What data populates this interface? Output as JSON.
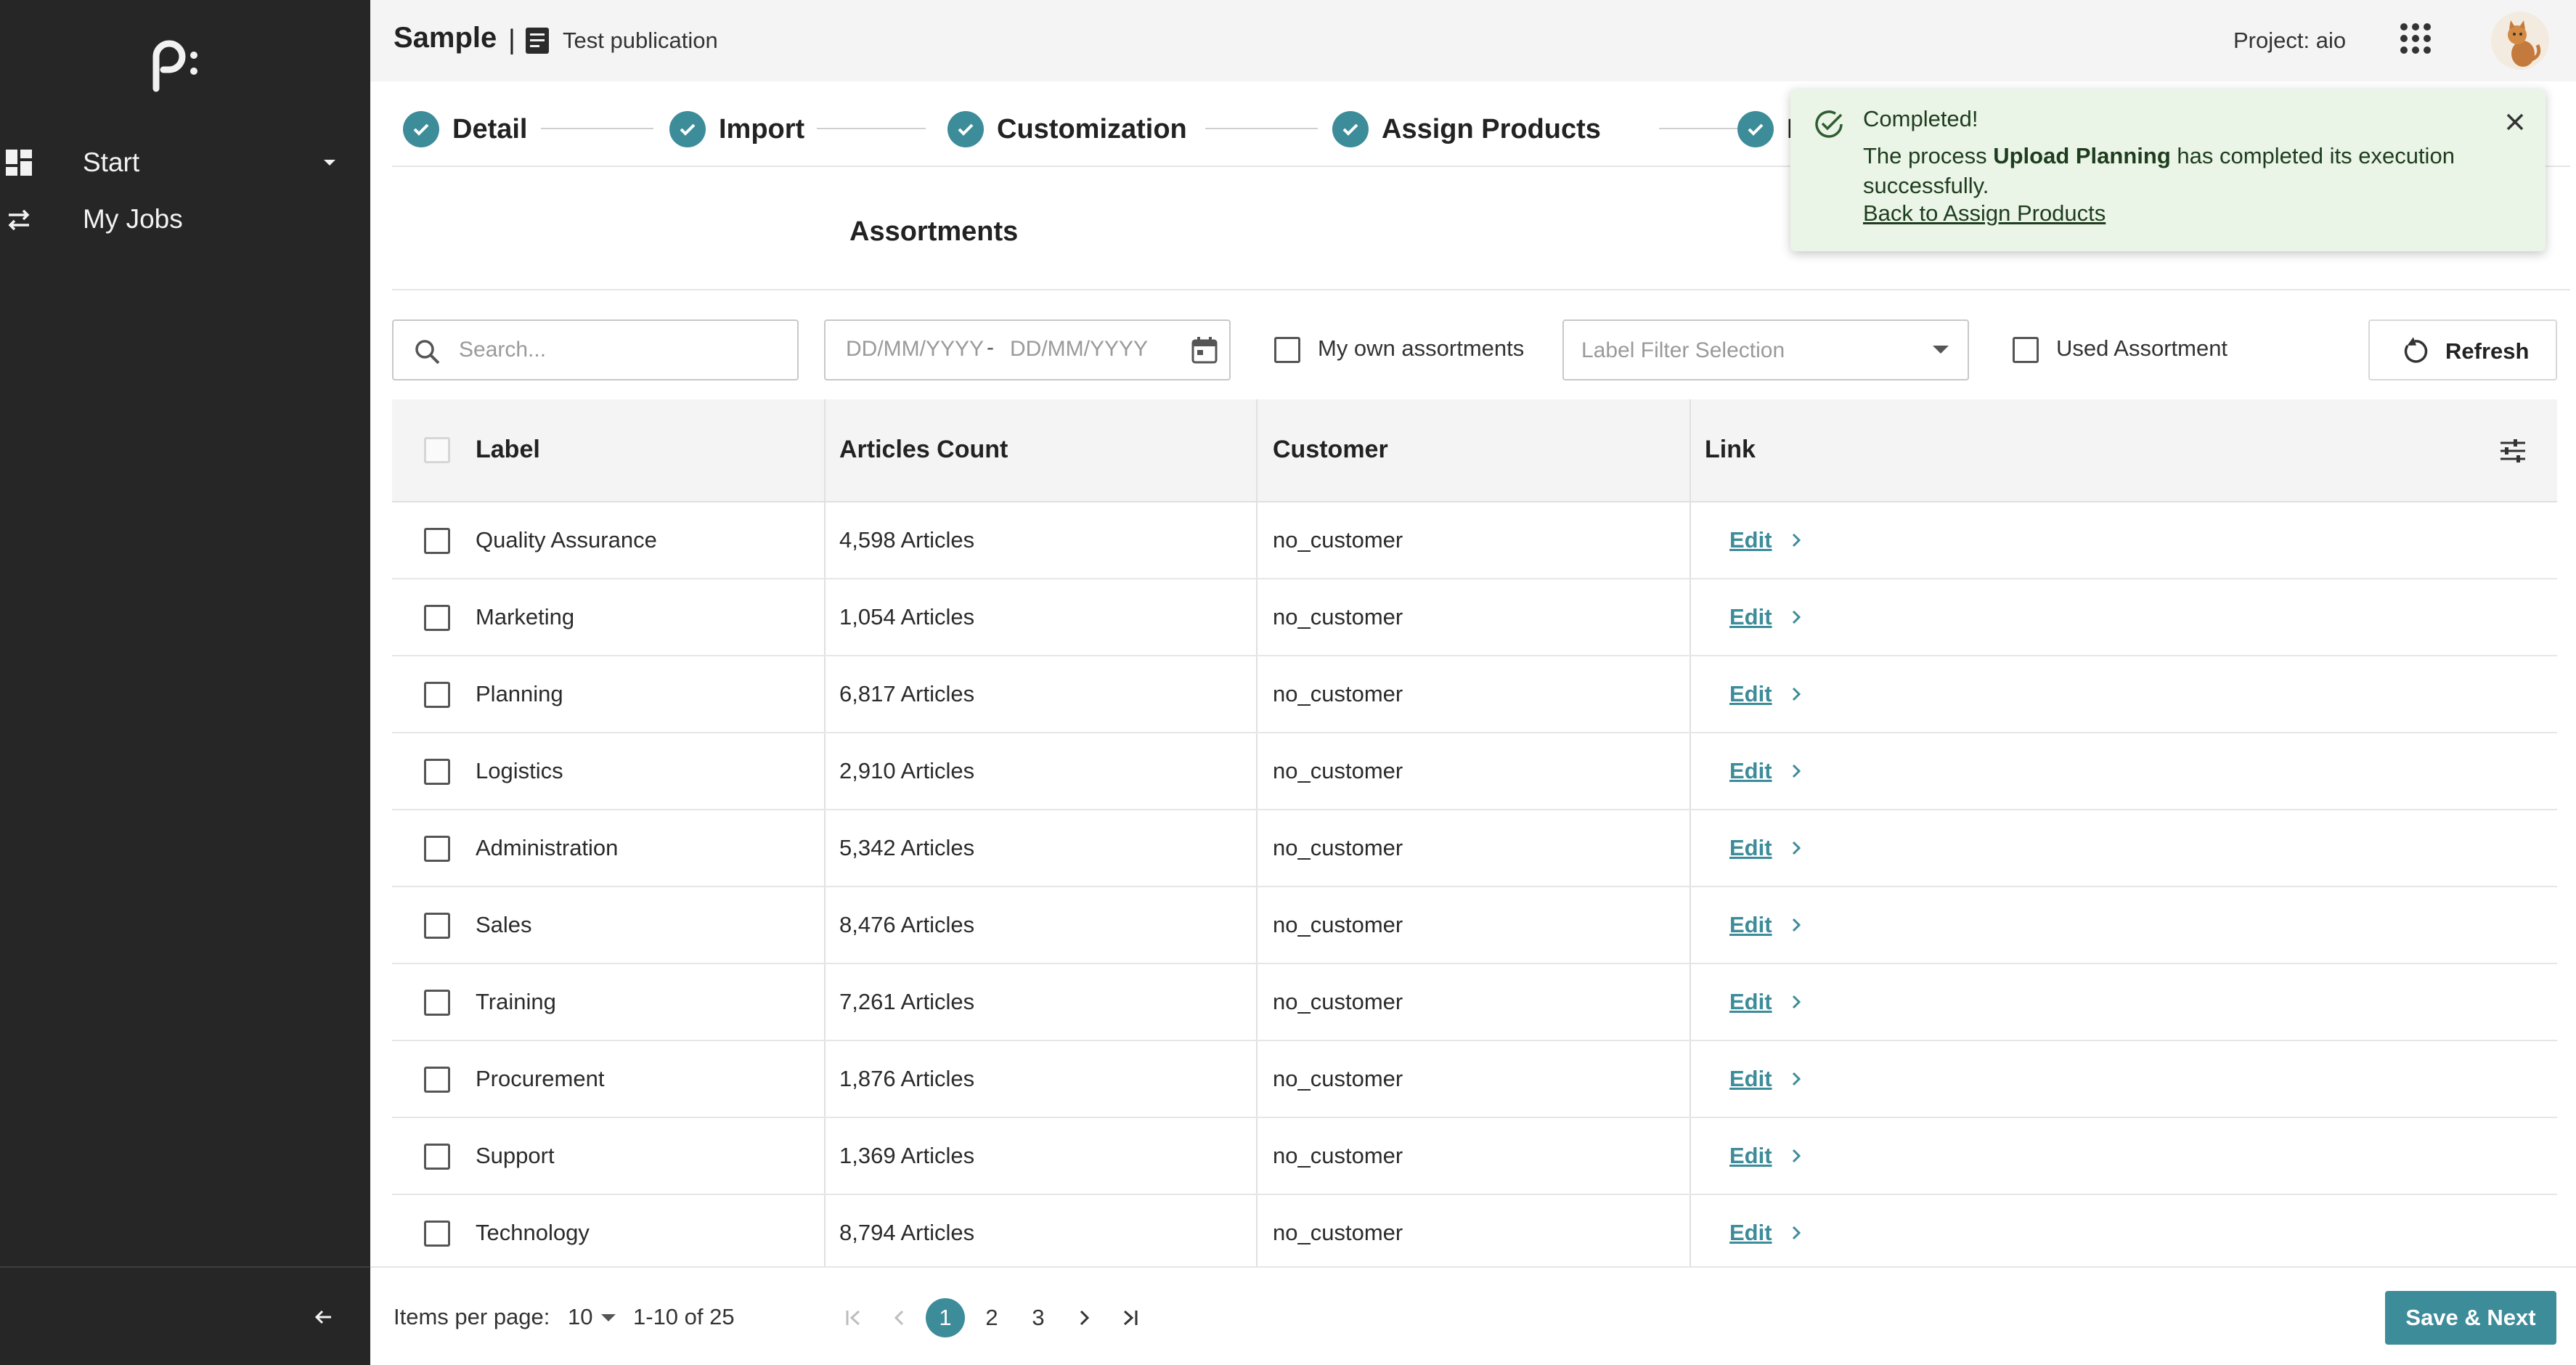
{
  "sidebar": {
    "nav": [
      {
        "label": "Start",
        "icon": "dashboard-icon"
      },
      {
        "label": "My Jobs",
        "icon": "swap-icon"
      }
    ]
  },
  "header": {
    "app_name": "Sample",
    "separator": "|",
    "publication": "Test publication",
    "project": "Project: aio"
  },
  "stepper": {
    "steps": [
      {
        "label": "Detail",
        "done": true
      },
      {
        "label": "Import",
        "done": true
      },
      {
        "label": "Customization",
        "done": true
      },
      {
        "label": "Assign Products",
        "done": true
      },
      {
        "label": "I",
        "done": true
      }
    ]
  },
  "section": {
    "title": "Assortments"
  },
  "filters": {
    "search_placeholder": "Search...",
    "date_start_placeholder": "DD/MM/YYYY",
    "date_separator": "-",
    "date_end_placeholder": "DD/MM/YYYY",
    "my_own_label": "My own assortments",
    "label_filter_placeholder": "Label Filter Selection",
    "used_label": "Used Assortment",
    "refresh_label": "Refresh"
  },
  "table": {
    "columns": [
      "Label",
      "Articles Count",
      "Customer",
      "Link"
    ],
    "edit_label": "Edit",
    "rows": [
      {
        "label": "Quality Assurance",
        "count": "4,598 Articles",
        "customer": "no_customer"
      },
      {
        "label": "Marketing",
        "count": "1,054 Articles",
        "customer": "no_customer"
      },
      {
        "label": "Planning",
        "count": "6,817 Articles",
        "customer": "no_customer"
      },
      {
        "label": "Logistics",
        "count": "2,910 Articles",
        "customer": "no_customer"
      },
      {
        "label": "Administration",
        "count": "5,342 Articles",
        "customer": "no_customer"
      },
      {
        "label": "Sales",
        "count": "8,476 Articles",
        "customer": "no_customer"
      },
      {
        "label": "Training",
        "count": "7,261 Articles",
        "customer": "no_customer"
      },
      {
        "label": "Procurement",
        "count": "1,876 Articles",
        "customer": "no_customer"
      },
      {
        "label": "Support",
        "count": "1,369 Articles",
        "customer": "no_customer"
      },
      {
        "label": "Technology",
        "count": "8,794 Articles",
        "customer": "no_customer"
      }
    ]
  },
  "footer": {
    "items_per_page_label": "Items per page:",
    "items_per_page": "10",
    "range": "1-10 of 25",
    "pages": [
      "1",
      "2",
      "3"
    ],
    "current_page": "1",
    "save_next_label": "Save & Next"
  },
  "toast": {
    "title": "Completed!",
    "msg_prefix": "The process ",
    "msg_bold": "Upload Planning",
    "msg_suffix": " has completed its execution successfully.",
    "link": "Back to Assign Products"
  },
  "colors": {
    "sidebar_bg": "#262626",
    "accent": "#3d8c9a",
    "toast_bg": "#eaf4e7"
  }
}
